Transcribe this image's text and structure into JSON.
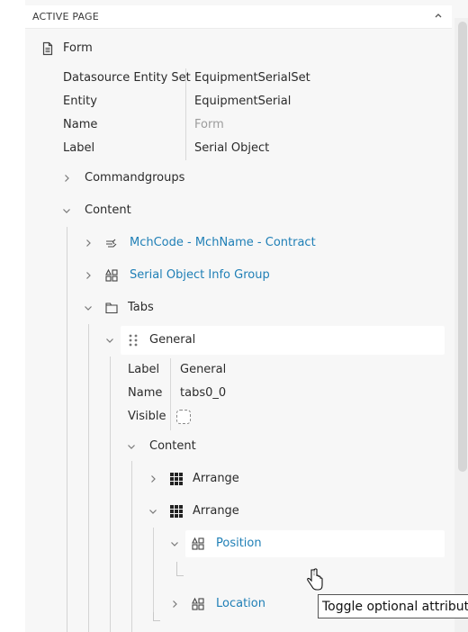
{
  "header": {
    "title": "ACTIVE PAGE"
  },
  "form": {
    "label": "Form",
    "properties": [
      {
        "key": "Datasource Entity Set",
        "value": "EquipmentSerialSet"
      },
      {
        "key": "Entity",
        "value": "EquipmentSerial"
      },
      {
        "key": "Name",
        "value": "Form"
      },
      {
        "key": "Label",
        "value": "Serial Object"
      }
    ]
  },
  "tree": {
    "commandgroups": "Commandgroups",
    "content": "Content",
    "mchcode": "MchCode - MchName - Contract",
    "serial_info": "Serial Object Info Group",
    "tabs": "Tabs",
    "general": "General",
    "general_props": [
      {
        "key": "Label",
        "value": "General"
      },
      {
        "key": "Name",
        "value": "tabs0_0"
      },
      {
        "key": "Visible",
        "value": ""
      }
    ],
    "inner_content": "Content",
    "arrange_1": "Arrange",
    "arrange_2": "Arrange",
    "position": "Position",
    "location": "Location"
  },
  "tooltip": "Toggle optional attributes",
  "colors": {
    "link": "#1f7fb6",
    "panel_bg": "#f7f7f7",
    "highlight": "#ffffff"
  }
}
